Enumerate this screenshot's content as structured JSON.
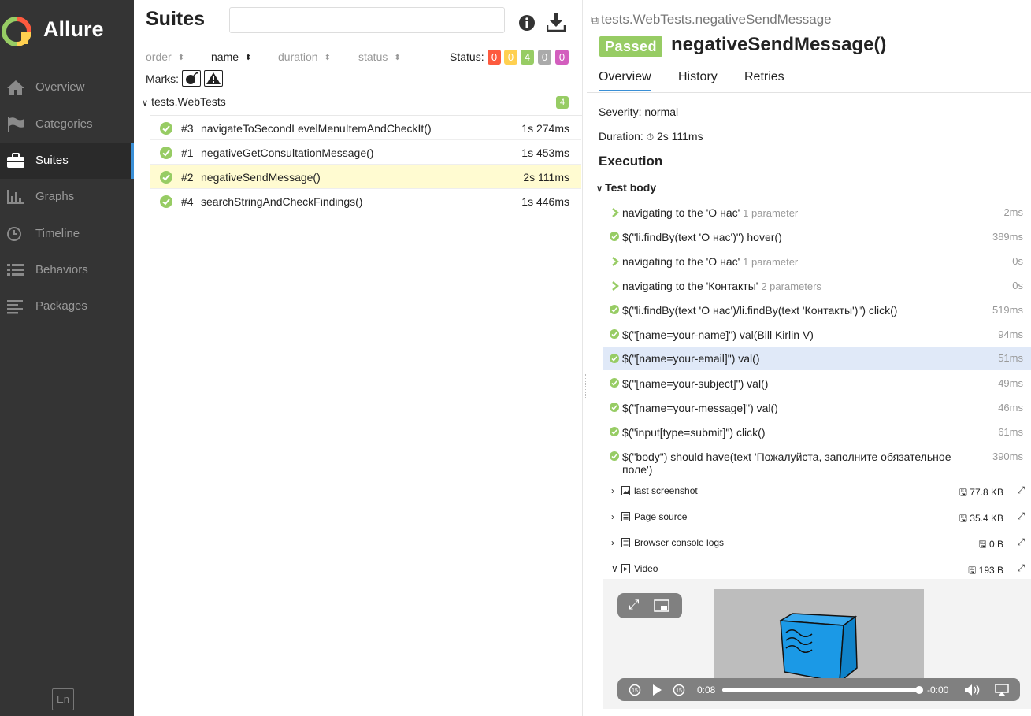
{
  "sidebar": {
    "brand": "Allure",
    "items": [
      {
        "label": "Overview",
        "icon": "home-icon"
      },
      {
        "label": "Categories",
        "icon": "flag-icon"
      },
      {
        "label": "Suites",
        "icon": "briefcase-icon"
      },
      {
        "label": "Graphs",
        "icon": "bar-chart-icon"
      },
      {
        "label": "Timeline",
        "icon": "clock-icon"
      },
      {
        "label": "Behaviors",
        "icon": "list-icon"
      },
      {
        "label": "Packages",
        "icon": "align-left-icon"
      }
    ],
    "language": "En"
  },
  "suites": {
    "title": "Suites",
    "search_value": "",
    "sort": [
      {
        "label": "order"
      },
      {
        "label": "name"
      },
      {
        "label": "duration"
      },
      {
        "label": "status"
      }
    ],
    "status_label": "Status:",
    "status_counts": [
      {
        "value": "0",
        "color": "#fd5a3e"
      },
      {
        "value": "0",
        "color": "#ffd050"
      },
      {
        "value": "4",
        "color": "#97cc64"
      },
      {
        "value": "0",
        "color": "#aaaaaa"
      },
      {
        "value": "0",
        "color": "#d35ebe"
      }
    ],
    "marks_label": "Marks:",
    "group": {
      "name": "tests.WebTests",
      "count": "4"
    },
    "tests": [
      {
        "num": "#3",
        "name": "navigateToSecondLevelMenuItemAndCheckIt()",
        "duration": "1s 274ms"
      },
      {
        "num": "#1",
        "name": "negativeGetConsultationMessage()",
        "duration": "1s 453ms"
      },
      {
        "num": "#2",
        "name": "negativeSendMessage()",
        "duration": "2s 111ms"
      },
      {
        "num": "#4",
        "name": "searchStringAndCheckFindings()",
        "duration": "1s 446ms"
      }
    ]
  },
  "detail": {
    "breadcrumb": "tests.WebTests.negativeSendMessage",
    "status": "Passed",
    "status_color": "#97cc64",
    "name": "negativeSendMessage()",
    "tabs": [
      "Overview",
      "History",
      "Retries"
    ],
    "severity": "Severity: normal",
    "duration_label": "Duration:",
    "duration": "2s 111ms",
    "execution": "Execution",
    "test_body": "Test body",
    "steps": [
      {
        "kind": "nav",
        "text": "navigating to the 'О нас'",
        "param": "1 parameter",
        "duration": "2ms"
      },
      {
        "kind": "ok",
        "text": "$(\"li.findBy(text 'О нас')\") hover()",
        "param": "",
        "duration": "389ms"
      },
      {
        "kind": "nav",
        "text": "navigating to the 'О нас'",
        "param": "1 parameter",
        "duration": "0s"
      },
      {
        "kind": "nav",
        "text": "navigating to the 'Контакты'",
        "param": "2 parameters",
        "duration": "0s"
      },
      {
        "kind": "ok",
        "text": "$(\"li.findBy(text 'О нас')/li.findBy(text 'Контакты')\") click()",
        "param": "",
        "duration": "519ms"
      },
      {
        "kind": "ok",
        "text": "$(\"[name=your-name]\") val(Bill Kirlin V)",
        "param": "",
        "duration": "94ms"
      },
      {
        "kind": "ok",
        "text": "$(\"[name=your-email]\") val()",
        "param": "",
        "duration": "51ms"
      },
      {
        "kind": "ok",
        "text": "$(\"[name=your-subject]\") val()",
        "param": "",
        "duration": "49ms"
      },
      {
        "kind": "ok",
        "text": "$(\"[name=your-message]\") val()",
        "param": "",
        "duration": "46ms"
      },
      {
        "kind": "ok",
        "text": "$(\"input[type=submit]\") click()",
        "param": "",
        "duration": "61ms"
      },
      {
        "kind": "ok",
        "text": "$(\"body\") should have(text 'Пожалуйста, заполните обязательное поле')",
        "param": "",
        "duration": "390ms"
      }
    ],
    "attachments": [
      {
        "name": "last screenshot",
        "size": "77.8 KB",
        "icon": "image-file-icon",
        "expanded": false
      },
      {
        "name": "Page source",
        "size": "35.4 KB",
        "icon": "text-file-icon",
        "expanded": false
      },
      {
        "name": "Browser console logs",
        "size": "0 B",
        "icon": "text-file-icon",
        "expanded": false
      },
      {
        "name": "Video",
        "size": "193 B",
        "icon": "video-file-icon",
        "expanded": true
      }
    ],
    "video": {
      "elapsed": "0:08",
      "remaining": "-0:00",
      "progress": 1.0
    }
  }
}
